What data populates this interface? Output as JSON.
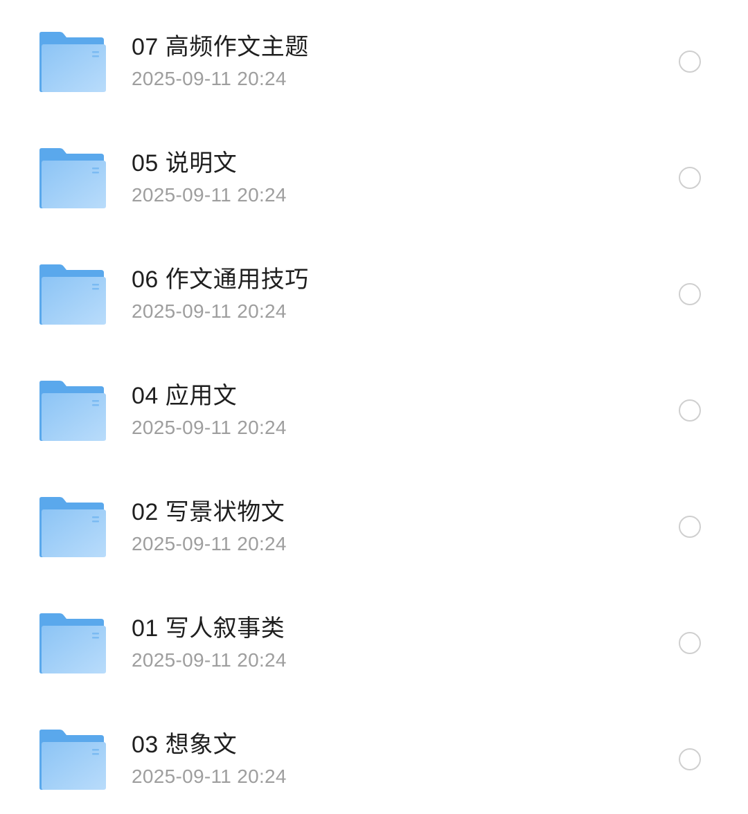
{
  "files": [
    {
      "name": "07 高频作文主题",
      "date": "2025-09-11 20:24",
      "icon": "folder-icon",
      "selected": false
    },
    {
      "name": "05 说明文",
      "date": "2025-09-11 20:24",
      "icon": "folder-icon",
      "selected": false
    },
    {
      "name": "06 作文通用技巧",
      "date": "2025-09-11 20:24",
      "icon": "folder-icon",
      "selected": false
    },
    {
      "name": "04 应用文",
      "date": "2025-09-11 20:24",
      "icon": "folder-icon",
      "selected": false
    },
    {
      "name": "02 写景状物文",
      "date": "2025-09-11 20:24",
      "icon": "folder-icon",
      "selected": false
    },
    {
      "name": "01 写人叙事类",
      "date": "2025-09-11 20:24",
      "icon": "folder-icon",
      "selected": false
    },
    {
      "name": "03 想象文",
      "date": "2025-09-11 20:24",
      "icon": "folder-icon",
      "selected": false
    }
  ],
  "colors": {
    "folder_back": "#5aa8ec",
    "folder_front_start": "#8cc4f5",
    "folder_front_end": "#b9dcfb",
    "name_text": "#1f1f1f",
    "date_text": "#9e9e9e",
    "radio_border": "#cfcfcf"
  }
}
